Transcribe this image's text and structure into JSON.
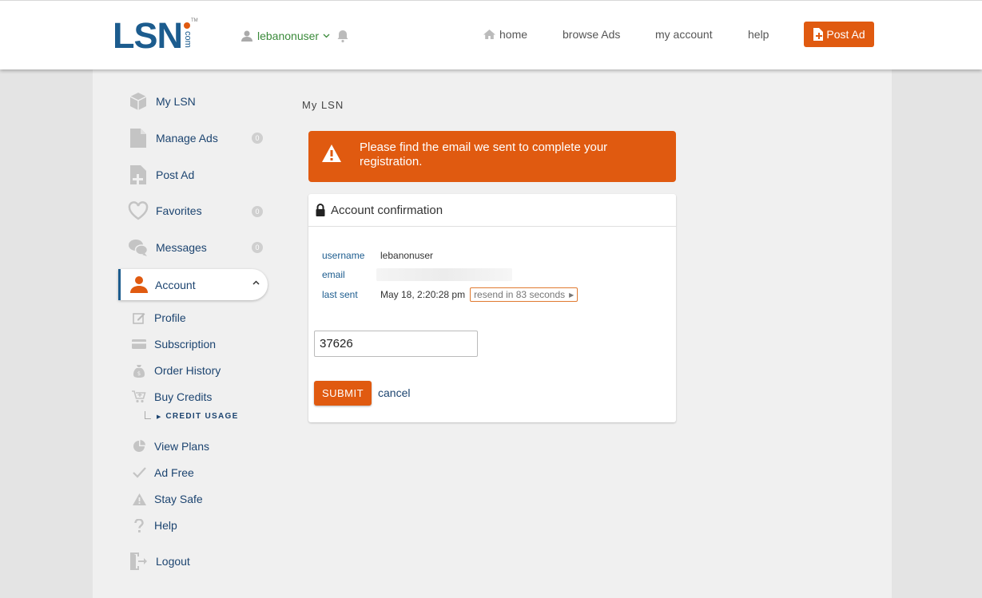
{
  "header": {
    "logo_text": "LSN",
    "logo_sub": "com",
    "logo_tm": "TM",
    "username": "lebanonuser",
    "nav": {
      "home": "home",
      "browse": "browse Ads",
      "account": "my account",
      "help": "help"
    },
    "post_ad": "Post Ad"
  },
  "sidebar": {
    "items": [
      {
        "label": "My LSN",
        "icon": "cube-icon"
      },
      {
        "label": "Manage Ads",
        "icon": "file-icon",
        "badge": "0"
      },
      {
        "label": "Post Ad",
        "icon": "file-plus-icon"
      },
      {
        "label": "Favorites",
        "icon": "heart-icon",
        "badge": "0"
      },
      {
        "label": "Messages",
        "icon": "chat-icon",
        "badge": "0"
      }
    ],
    "account": {
      "label": "Account",
      "icon": "user-icon"
    },
    "sub_items": [
      {
        "label": "Profile",
        "icon": "edit-icon"
      },
      {
        "label": "Subscription",
        "icon": "credit-card-icon"
      },
      {
        "label": "Order History",
        "icon": "money-bag-icon"
      },
      {
        "label": "Buy Credits",
        "icon": "cart-icon"
      }
    ],
    "credit_usage": "CREDIT USAGE",
    "sub_items_2": [
      {
        "label": "View Plans",
        "icon": "pie-chart-icon"
      },
      {
        "label": "Ad Free",
        "icon": "check-icon"
      },
      {
        "label": "Stay Safe",
        "icon": "warning-icon"
      },
      {
        "label": "Help",
        "icon": "question-icon"
      }
    ],
    "logout": {
      "label": "Logout",
      "icon": "logout-icon"
    }
  },
  "content": {
    "page_title": "My LSN",
    "alert_text": "Please find the email we sent to complete your registration.",
    "card_title": "Account confirmation",
    "fields": {
      "username_label": "username",
      "username_value": "lebanonuser",
      "email_label": "email",
      "last_sent_label": "last sent",
      "last_sent_value": "May 18, 2:20:28 pm",
      "resend_label": "resend in 83 seconds"
    },
    "code_value": "37626",
    "submit_label": "SUBMIT",
    "cancel_label": "cancel"
  },
  "colors": {
    "brand_blue": "#1c5c8e",
    "accent_orange": "#e05a10",
    "link_blue": "#1c4470",
    "user_green": "#3a8a3a"
  }
}
